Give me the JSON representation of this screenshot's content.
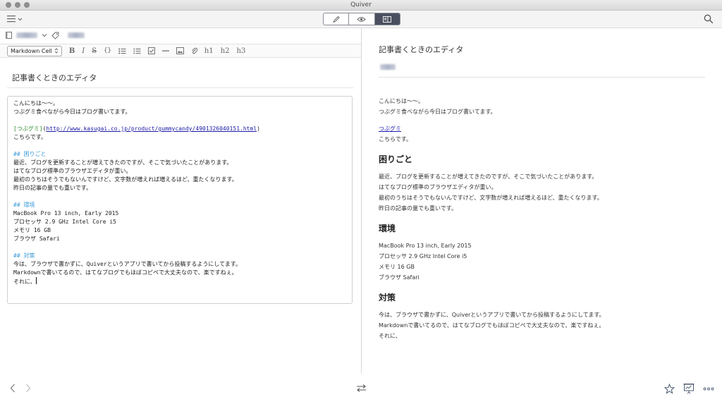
{
  "window": {
    "title": "Quiver"
  },
  "toolbar": {
    "view_modes": [
      {
        "name": "edit",
        "icon": "pencil-icon"
      },
      {
        "name": "preview",
        "icon": "eye-icon"
      },
      {
        "name": "split",
        "icon": "split-view-icon",
        "active": true
      }
    ]
  },
  "editor": {
    "cell_type": "Markdown Cell",
    "format_buttons": [
      "B",
      "I",
      "S",
      "{}",
      "h1",
      "h2",
      "h3"
    ],
    "note_title": "記事書くときのエディタ",
    "lines": [
      "こんにちは〜〜。",
      "つぶグミ食べながら今日はブログ書いてます。",
      "",
      "[つぶグミ](http://www.kasugai.co.jp/product/gummycandy/4901326040151.html)",
      "こちらです。",
      "",
      "## 困りごと",
      "最近、ブログを更新することが増えてきたのですが、そこで気づいたことがあります。",
      "はてなブログ標準のブラウザエディタが重い。",
      "最初のうちはそうでもないんですけど、文字数が増えれば増えるほど、重たくなります。",
      "昨日の記事の量でも重いです。",
      "",
      "## 環境",
      "MacBook Pro 13 inch, Early 2015",
      "プロセッサ 2.9 GHz Intel Core i5",
      "メモリ 16 GB",
      "ブラウザ Safari",
      "",
      "## 対策",
      "今は、ブラウザで書かずに、Quiverというアプリで書いてから投稿するようにしてます。",
      "Markdownで書いてるので、はてなブログでもほぼコピペで大丈夫なので、楽ですねぇ。",
      "それに、"
    ]
  },
  "preview": {
    "title": "記事書くときのエディタ",
    "blocks": [
      {
        "type": "p",
        "lines": [
          "こんにちは〜〜。",
          "つぶグミ食べながら今日はブログ書いてます。"
        ]
      },
      {
        "type": "p",
        "link": "つぶグミ",
        "lines": [
          "こちらです。"
        ]
      },
      {
        "type": "h",
        "text": "困りごと"
      },
      {
        "type": "p",
        "lines": [
          "最近、ブログを更新することが増えてきたのですが、そこで気づいたことがあります。",
          "はてなブログ標準のブラウザエディタが重い。",
          "最初のうちはそうでもないんですけど、文字数が増えれば増えるほど、重たくなります。",
          "昨日の記事の量でも重いです。"
        ]
      },
      {
        "type": "h",
        "text": "環境"
      },
      {
        "type": "p",
        "lines": [
          "MacBook Pro 13 inch, Early 2015",
          "プロセッサ 2.9 GHz Intel Core i5",
          "メモリ 16 GB",
          "ブラウザ Safari"
        ]
      },
      {
        "type": "h",
        "text": "対策"
      },
      {
        "type": "p",
        "lines": [
          "今は、ブラウザで書かずに、Quiverというアプリで書いてから投稿するようにしてます。",
          "Markdownで書いてるので、はてなブログでもほぼコピペで大丈夫なので、楽ですねぇ。",
          "それに、"
        ]
      }
    ]
  },
  "colors": {
    "heading_md": "#3a9ad9",
    "link": "#1a1ab0",
    "active_segment": "#4a5060"
  }
}
